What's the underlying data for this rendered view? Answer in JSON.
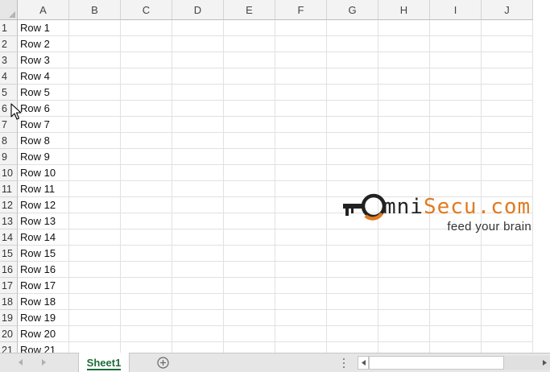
{
  "columns": [
    "A",
    "B",
    "C",
    "D",
    "E",
    "F",
    "G",
    "H",
    "I",
    "J"
  ],
  "rows": [
    {
      "num": "1",
      "a": "Row 1"
    },
    {
      "num": "2",
      "a": "Row 2"
    },
    {
      "num": "3",
      "a": "Row 3"
    },
    {
      "num": "4",
      "a": "Row 4"
    },
    {
      "num": "5",
      "a": "Row 5"
    },
    {
      "num": "6",
      "a": "Row 6"
    },
    {
      "num": "7",
      "a": "Row 7"
    },
    {
      "num": "8",
      "a": "Row 8"
    },
    {
      "num": "9",
      "a": "Row 9"
    },
    {
      "num": "10",
      "a": "Row 10"
    },
    {
      "num": "11",
      "a": "Row 11"
    },
    {
      "num": "12",
      "a": "Row 12"
    },
    {
      "num": "13",
      "a": "Row 13"
    },
    {
      "num": "14",
      "a": "Row 14"
    },
    {
      "num": "15",
      "a": "Row 15"
    },
    {
      "num": "16",
      "a": "Row 16"
    },
    {
      "num": "17",
      "a": "Row 17"
    },
    {
      "num": "18",
      "a": "Row 18"
    },
    {
      "num": "19",
      "a": "Row 19"
    },
    {
      "num": "20",
      "a": "Row 20"
    },
    {
      "num": "21",
      "a": "Row 21"
    }
  ],
  "sheet_tab": {
    "label": "Sheet1",
    "active_color": "#1e6b3a"
  },
  "icons": {
    "add_sheet": "plus-circle-icon",
    "nav_prev": "triangle-left-icon",
    "nav_next": "triangle-right-icon",
    "cursor": "mouse-pointer-icon",
    "scroll_left": "triangle-left-icon",
    "scroll_right": "triangle-right-icon"
  },
  "logo": {
    "name_dark": "mni",
    "name_orange": "Secu.com",
    "tagline": "feed your brain",
    "brand_dark": "#222222",
    "brand_orange": "#e07b20"
  }
}
